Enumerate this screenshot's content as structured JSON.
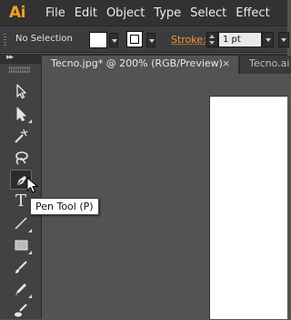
{
  "app": {
    "logo": "Ai",
    "menu": [
      "File",
      "Edit",
      "Object",
      "Type",
      "Select",
      "Effect"
    ]
  },
  "control_bar": {
    "selection_label": "No Selection",
    "stroke_label": "Stroke:",
    "stroke_weight": "1 pt"
  },
  "tabs": [
    {
      "label": "Tecno.jpg* @ 200% (RGB/Preview)",
      "close": "×"
    },
    {
      "label": "Tecno.ai"
    }
  ],
  "tools": {
    "collapse": "▸▸",
    "items": [
      {
        "name": "selection-tool"
      },
      {
        "name": "direct-selection-tool"
      },
      {
        "name": "magic-wand-tool"
      },
      {
        "name": "lasso-tool"
      },
      {
        "name": "pen-tool",
        "selected": true
      },
      {
        "name": "type-tool",
        "glyph": "T"
      },
      {
        "name": "line-segment-tool"
      },
      {
        "name": "rectangle-tool"
      },
      {
        "name": "paintbrush-tool"
      },
      {
        "name": "pencil-tool"
      },
      {
        "name": "blob-brush-tool"
      }
    ]
  },
  "tooltip": {
    "text": "Pen Tool (P)"
  },
  "colors": {
    "brand": "#f7a21d",
    "stroke_label": "#f39a3a",
    "canvas_bg": "#535353",
    "artboard": "#ffffff"
  }
}
